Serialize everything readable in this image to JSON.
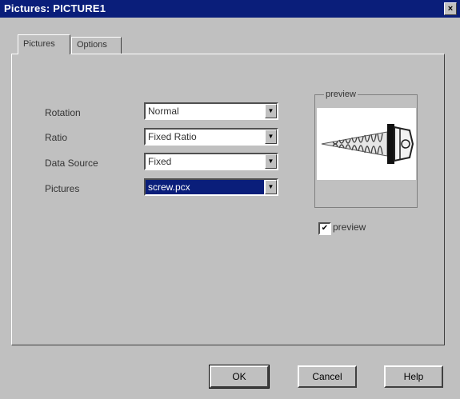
{
  "window": {
    "title": "Pictures: PICTURE1",
    "close_glyph": "×"
  },
  "tabs": [
    {
      "label": "Pictures",
      "active": true
    },
    {
      "label": "Options",
      "active": false
    }
  ],
  "fields": [
    {
      "label": "Rotation",
      "value": "Normal"
    },
    {
      "label": "Ratio",
      "value": "Fixed Ratio"
    },
    {
      "label": "Data Source",
      "value": "Fixed"
    },
    {
      "label": "Pictures",
      "value": "screw.pcx",
      "selected": true
    }
  ],
  "preview": {
    "group_label": "preview",
    "checkbox_label": "preview",
    "checked": true,
    "image": "screw-image"
  },
  "buttons": {
    "ok": "OK",
    "cancel": "Cancel",
    "help": "Help"
  },
  "colors": {
    "titlebar": "#0a1e7a",
    "face": "#c0c0c0",
    "selection": "#0a1e7a"
  }
}
